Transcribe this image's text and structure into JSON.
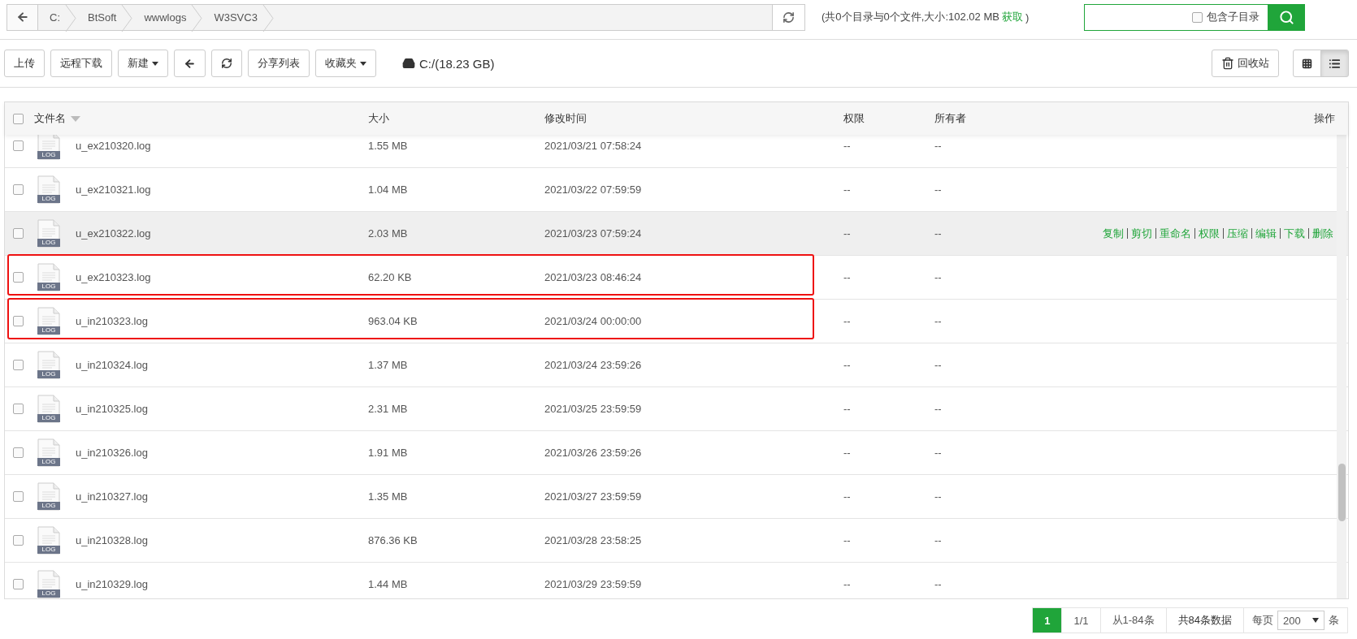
{
  "path_bar": {
    "crumbs": [
      "C:",
      "BtSoft",
      "wwwlogs",
      "W3SVC3"
    ],
    "summary": "(共0个目录与0个文件,大小:102.02 MB",
    "summary_link": "获取",
    "summary_end": ")"
  },
  "search": {
    "option": {
      "label": "包含子目录",
      "checked": false
    }
  },
  "toolbar": {
    "buttons": [
      {
        "kind": "text",
        "label": "上传"
      },
      {
        "kind": "text",
        "label": "远程下载"
      },
      {
        "kind": "dropdown",
        "label": "新建"
      },
      {
        "kind": "back"
      },
      {
        "kind": "refresh"
      },
      {
        "kind": "text",
        "label": "分享列表"
      },
      {
        "kind": "dropdown",
        "label": "收藏夹"
      }
    ],
    "disk": "C:/(18.23 GB)",
    "recycle": "回收站",
    "views": [
      {
        "kind": "grid",
        "selected": false
      },
      {
        "kind": "list",
        "selected": true
      }
    ]
  },
  "table": {
    "all_checked": false,
    "columns": [
      "文件名",
      "大小",
      "修改时间",
      "权限",
      "所有者",
      "操作"
    ],
    "rows": [
      {
        "name": "u_ex210320.log",
        "type_label": "LOG",
        "size": "1.55 MB",
        "modified": "2021/03/21 07:58:24",
        "permission": "--",
        "owner": "--",
        "checked": false,
        "hovered": false,
        "annotated": false
      },
      {
        "name": "u_ex210321.log",
        "type_label": "LOG",
        "size": "1.04 MB",
        "modified": "2021/03/22 07:59:59",
        "permission": "--",
        "owner": "--",
        "checked": false,
        "hovered": false,
        "annotated": false
      },
      {
        "name": "u_ex210322.log",
        "type_label": "LOG",
        "size": "2.03 MB",
        "modified": "2021/03/23 07:59:24",
        "permission": "--",
        "owner": "--",
        "checked": false,
        "hovered": true,
        "annotated": false,
        "actions": [
          "复制",
          "剪切",
          "重命名",
          "权限",
          "压缩",
          "编辑",
          "下载",
          "删除"
        ]
      },
      {
        "name": "u_ex210323.log",
        "type_label": "LOG",
        "size": "62.20 KB",
        "modified": "2021/03/23 08:46:24",
        "permission": "--",
        "owner": "--",
        "checked": false,
        "hovered": false,
        "annotated": true
      },
      {
        "name": "u_in210323.log",
        "type_label": "LOG",
        "size": "963.04 KB",
        "modified": "2021/03/24 00:00:00",
        "permission": "--",
        "owner": "--",
        "checked": false,
        "hovered": false,
        "annotated": true
      },
      {
        "name": "u_in210324.log",
        "type_label": "LOG",
        "size": "1.37 MB",
        "modified": "2021/03/24 23:59:26",
        "permission": "--",
        "owner": "--",
        "checked": false,
        "hovered": false,
        "annotated": false
      },
      {
        "name": "u_in210325.log",
        "type_label": "LOG",
        "size": "2.31 MB",
        "modified": "2021/03/25 23:59:59",
        "permission": "--",
        "owner": "--",
        "checked": false,
        "hovered": false,
        "annotated": false
      },
      {
        "name": "u_in210326.log",
        "type_label": "LOG",
        "size": "1.91 MB",
        "modified": "2021/03/26 23:59:26",
        "permission": "--",
        "owner": "--",
        "checked": false,
        "hovered": false,
        "annotated": false
      },
      {
        "name": "u_in210327.log",
        "type_label": "LOG",
        "size": "1.35 MB",
        "modified": "2021/03/27 23:59:59",
        "permission": "--",
        "owner": "--",
        "checked": false,
        "hovered": false,
        "annotated": false
      },
      {
        "name": "u_in210328.log",
        "type_label": "LOG",
        "size": "876.36 KB",
        "modified": "2021/03/28 23:58:25",
        "permission": "--",
        "owner": "--",
        "checked": false,
        "hovered": false,
        "annotated": false
      },
      {
        "name": "u_in210329.log",
        "type_label": "LOG",
        "size": "1.44 MB",
        "modified": "2021/03/29 23:59:59",
        "permission": "--",
        "owner": "--",
        "checked": false,
        "hovered": false,
        "annotated": false
      }
    ]
  },
  "pagination": {
    "pages": [
      {
        "label": "1",
        "selected": true
      }
    ],
    "page_count": "1/1",
    "range": "从1-84条",
    "total": "共84条数据",
    "per_page_label": "每页",
    "per_page": "200",
    "per_page_unit": "条"
  }
}
